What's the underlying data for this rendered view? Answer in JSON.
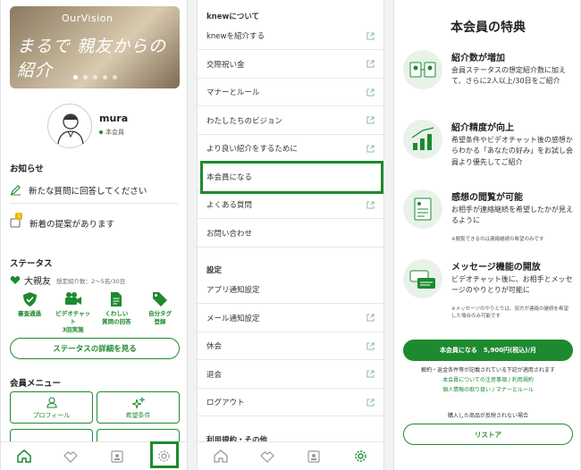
{
  "colors": {
    "accent": "#1e8a2f",
    "icon_bg": "#e8f2e9"
  },
  "home": {
    "banner": {
      "brand": "OurVision",
      "script": "まるで 親友からの紹介"
    },
    "user": {
      "name": "mura",
      "rank": "本会員"
    },
    "news": {
      "heading": "お知らせ",
      "items": [
        {
          "icon": "pencil-icon",
          "label": "新たな質問に回答してください"
        },
        {
          "icon": "bell-icon",
          "badge": "1",
          "label": "新着の提案があります"
        }
      ]
    },
    "status": {
      "heading": "ステータス",
      "level": "大親友",
      "sub": "想定紹介数：2〜5名/30日",
      "badges": [
        {
          "icon": "check-shield-icon",
          "label": "審査通過"
        },
        {
          "icon": "video-icon",
          "label": "ビデオチャット\n3回実施"
        },
        {
          "icon": "document-icon",
          "label": "くわしい\n質問の回答"
        },
        {
          "icon": "tag-icon",
          "label": "自分タグ\n登録"
        }
      ],
      "button": "ステータスの詳細を見る"
    },
    "menu": {
      "heading": "会員メニュー",
      "items": [
        {
          "icon": "person-icon",
          "label": "プロフィール"
        },
        {
          "icon": "sparkle-icon",
          "label": "希望条件"
        }
      ]
    }
  },
  "settings": {
    "knew_heading": "knewについて",
    "knew_items": [
      {
        "label": "knewを紹介する",
        "external": true
      },
      {
        "label": "交際祝い金",
        "external": true
      },
      {
        "label": "マナーとルール",
        "external": true
      },
      {
        "label": "わたしたちのビジョン",
        "external": true
      },
      {
        "label": "より良い紹介をするために",
        "external": true
      },
      {
        "label": "本会員になる",
        "external": false
      },
      {
        "label": "よくある質問",
        "external": true
      },
      {
        "label": "お問い合わせ",
        "external": false
      }
    ],
    "settings_heading": "設定",
    "settings_items": [
      {
        "label": "アプリ通知設定",
        "external": false
      },
      {
        "label": "メール通知設定",
        "external": true
      },
      {
        "label": "休会",
        "external": true
      },
      {
        "label": "退会",
        "external": true
      },
      {
        "label": "ログアウト",
        "external": true
      }
    ],
    "terms_heading": "利用規約・その他"
  },
  "benefits": {
    "title": "本会員の特典",
    "features": [
      {
        "icon": "profile-cards-icon",
        "title": "紹介数が増加",
        "desc": "会員ステータスの想定紹介数に加えて、さらに2人以上/30日をご紹介",
        "note": ""
      },
      {
        "icon": "growth-chart-icon",
        "title": "紹介精度が向上",
        "desc": "希望条件やビデオチャット後の感想からわかる「あなたの好み」をお試し会員より優先してご紹介",
        "note": ""
      },
      {
        "icon": "document-list-icon",
        "title": "感想の閲覧が可能",
        "desc": "お相手が連絡継続を希望したかが見えるように",
        "note": "※閲覧できるのは連絡継続の希望のみです"
      },
      {
        "icon": "message-icon",
        "title": "メッセージ機能の開放",
        "desc": "ビデオチャット後に、お相手とメッセージのやりとりが可能に",
        "note": "※メッセージのやりとりは、双方が連絡の継続を希望した場合のみ可能です"
      }
    ],
    "cta": "本会員になる　5,900円(税込)/月",
    "fine1": "解約・返金条件等が記載されている下記が適用されます",
    "link1": "本会員についての注意事項 / 利用規約",
    "link2": "個人情報の取り扱い / マナーとルール",
    "fine2": "購入した商品が反映されない場合",
    "restore": "リストア"
  },
  "tabs": [
    "home-icon",
    "handshake-icon",
    "profile-card-icon",
    "gear-icon"
  ]
}
